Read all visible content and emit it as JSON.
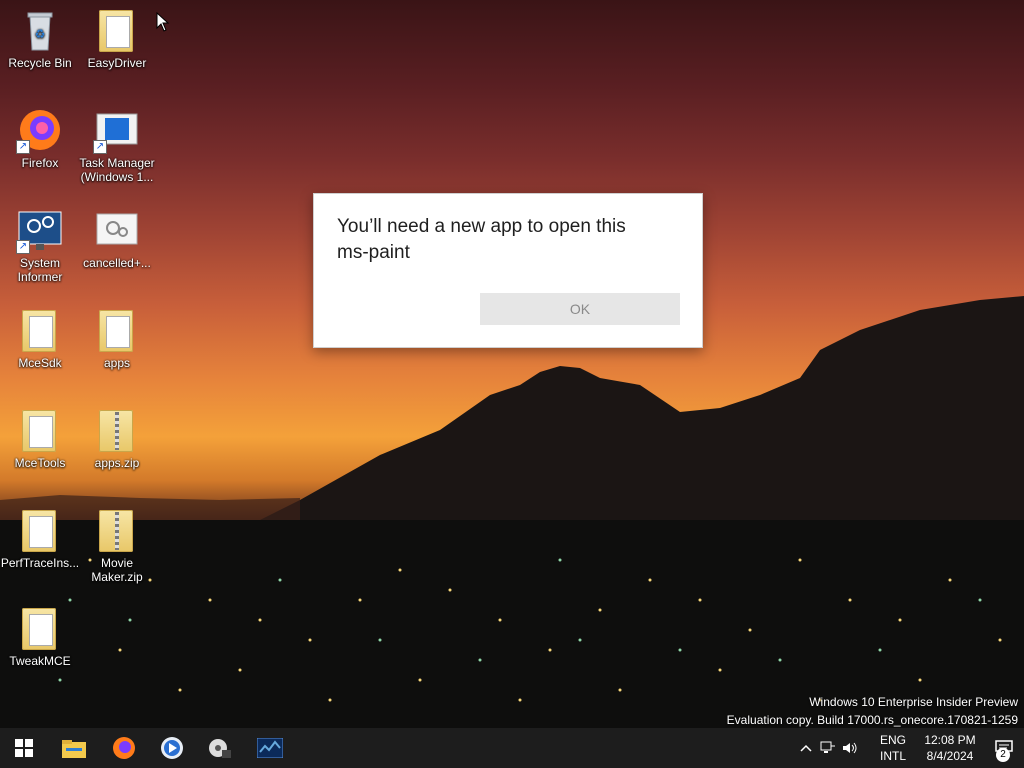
{
  "desktop": {
    "icons": [
      {
        "label": "Recycle Bin"
      },
      {
        "label": "EasyDriver"
      },
      {
        "label": "Firefox"
      },
      {
        "label": "Task Manager (Windows 1..."
      },
      {
        "label": "System Informer"
      },
      {
        "label": "cancelled+..."
      },
      {
        "label": "MceSdk"
      },
      {
        "label": "apps"
      },
      {
        "label": "MceTools"
      },
      {
        "label": "apps.zip"
      },
      {
        "label": "PerfTraceIns..."
      },
      {
        "label": "Movie Maker.zip"
      },
      {
        "label": "TweakMCE"
      }
    ]
  },
  "dialog": {
    "title_line1": "You’ll need a new app to open this",
    "title_line2": "ms-paint",
    "ok_label": "OK"
  },
  "watermark": {
    "line1": "Windows 10 Enterprise Insider Preview",
    "line2": "Evaluation copy. Build 17000.rs_onecore.170821-1259"
  },
  "taskbar": {
    "pinned": [
      "start-button",
      "file-explorer",
      "firefox",
      "media-player",
      "movie-maker",
      "task-manager"
    ],
    "tray": {
      "lang_line1": "ENG",
      "lang_line2": "INTL",
      "time": "12:08 PM",
      "date": "8/4/2024",
      "notification_count": "2"
    }
  },
  "colors": {
    "taskbar": "#1d1d1d",
    "dialog_bg": "#ffffff",
    "button_disabled": "#e6e6e6"
  }
}
